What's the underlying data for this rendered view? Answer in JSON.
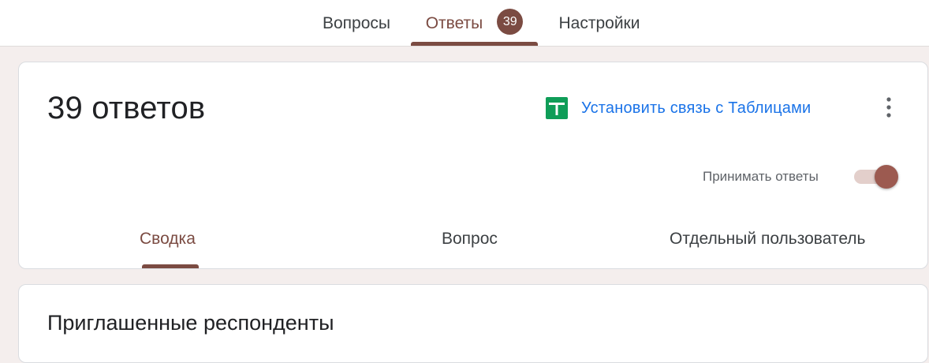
{
  "top_tabs": {
    "questions": "Вопросы",
    "responses": "Ответы",
    "responses_badge": "39",
    "settings": "Настройки",
    "active": "responses"
  },
  "summary_card": {
    "response_count_text": "39 ответов",
    "sheets_link_label": "Установить связь с Таблицами",
    "accept_label": "Принимать ответы",
    "accept_enabled": true,
    "sub_tabs": {
      "summary": "Сводка",
      "question": "Вопрос",
      "individual": "Отдельный пользователь",
      "active": "summary"
    }
  },
  "invited_card": {
    "title": "Приглашенные респонденты"
  },
  "icons": {
    "sheets": "google-sheets-icon",
    "more": "more-vert-icon"
  },
  "colors": {
    "accent": "#7b4b42",
    "link": "#1a73e8",
    "sheets_green": "#0f9d58",
    "background": "#f4eeed"
  }
}
